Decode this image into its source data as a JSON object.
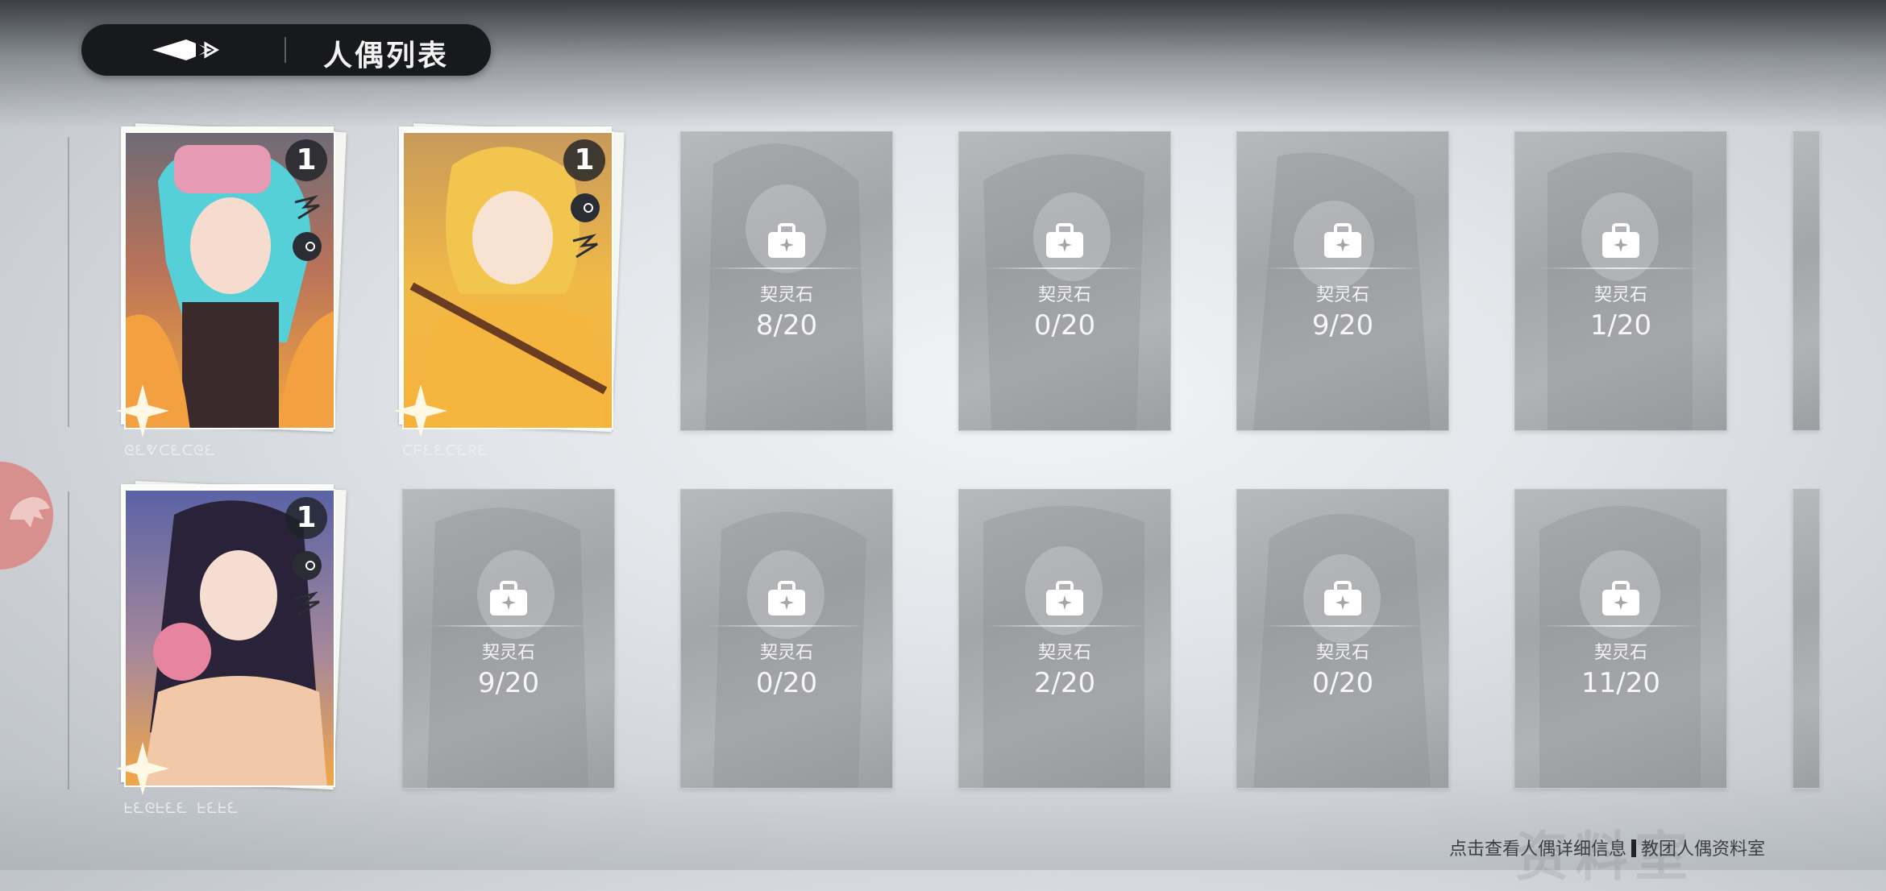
{
  "header": {
    "title": "人偶列表",
    "back_icon": "arrow-left-icon"
  },
  "owned": [
    {
      "id": "doll-1",
      "level": "1",
      "runes": "ᘓᘍᕓᑕᘍᑕᘓᘍ"
    },
    {
      "id": "doll-2",
      "level": "1",
      "runes": "ᑕᖴᘍᘍᑕᘍᖇᘍ"
    },
    {
      "id": "doll-3",
      "level": "1",
      "runes": "ᖶᘍᘓᖶᘍᘍ ᖶᘍᖶᘍ"
    }
  ],
  "locked_label": "契灵石",
  "locked": [
    {
      "count": "8/20"
    },
    {
      "count": "0/20"
    },
    {
      "count": "9/20"
    },
    {
      "count": "1/20"
    },
    {
      "count": "9/20"
    },
    {
      "count": "0/20"
    },
    {
      "count": "2/20"
    },
    {
      "count": "0/20"
    },
    {
      "count": "11/20"
    }
  ],
  "footer": {
    "hint_left": "点击查看人偶详细信息",
    "hint_right": "教团人偶资料室",
    "watermark": "资料室"
  },
  "colors": {
    "header_bg": "#17191c",
    "card_locked": "#a7a9ac",
    "art_warm": "#f2a43a",
    "side_button": "#d98a86"
  }
}
